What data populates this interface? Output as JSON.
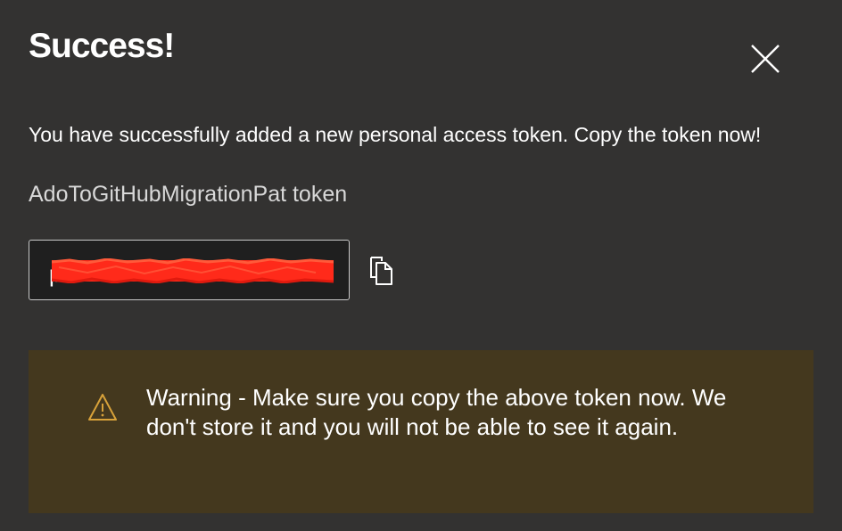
{
  "dialog": {
    "title": "Success!",
    "message": "You have successfully added a new personal access token. Copy the token now!",
    "token_name": "AdoToGitHubMigrationPat token",
    "token_value": "p",
    "close_icon": "close-icon",
    "copy_icon": "copy-icon"
  },
  "warning": {
    "icon": "warning-icon",
    "text": "Warning - Make sure you copy the above token now. We don't store it and you will not be able to see it again."
  },
  "colors": {
    "background": "#333231",
    "warning_background": "#44381e",
    "warning_icon": "#d8a23a",
    "redaction": "#ff2a1a"
  }
}
